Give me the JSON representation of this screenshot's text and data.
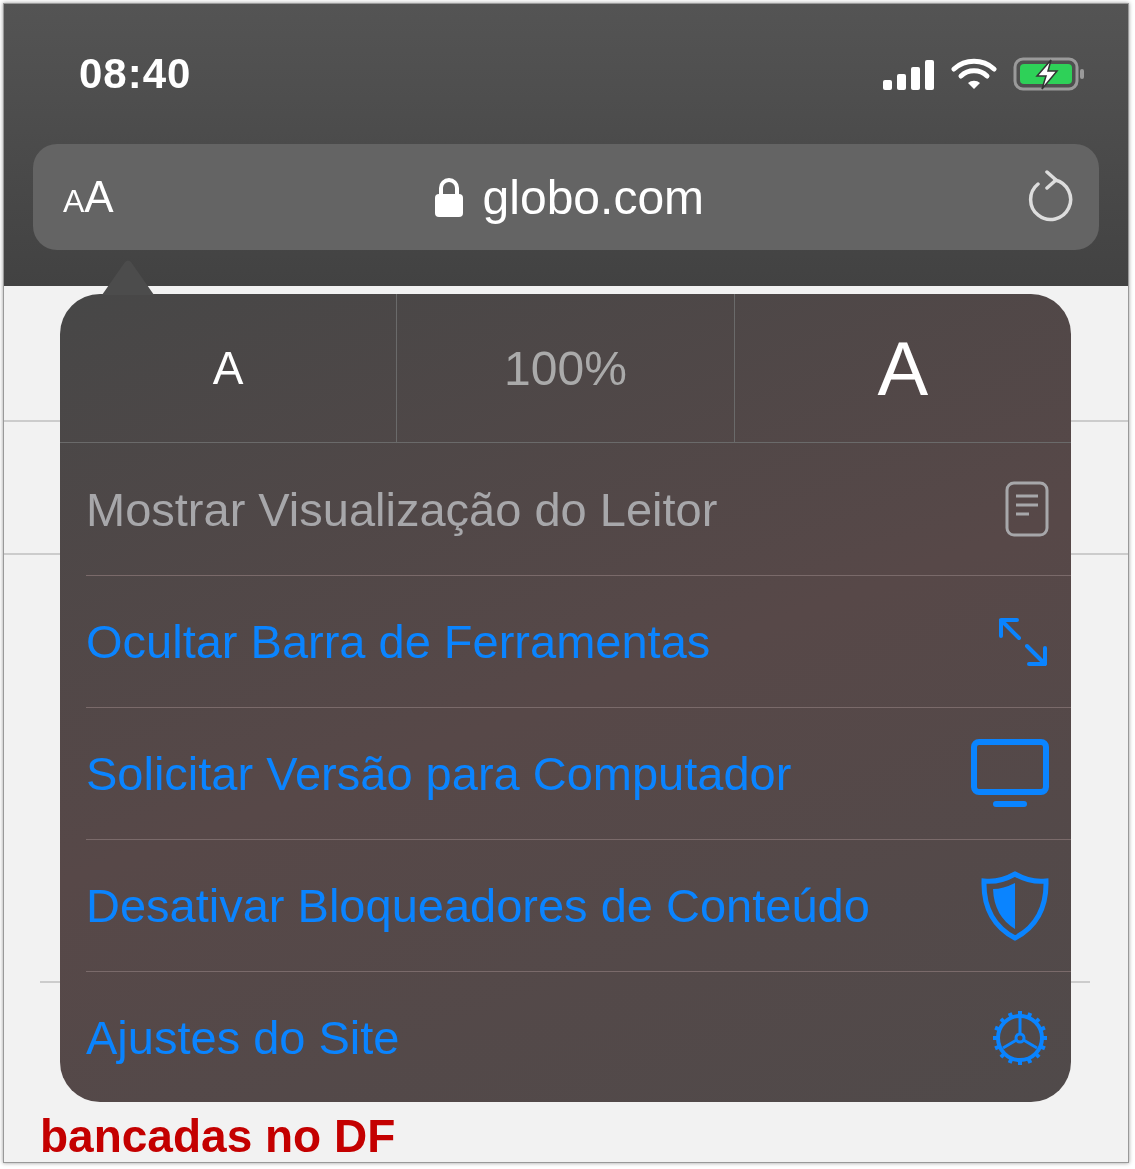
{
  "status_bar": {
    "time": "08:40",
    "battery_charging": true
  },
  "address_bar": {
    "text_size_small": "A",
    "text_size_large": "A",
    "secure": true,
    "domain": "globo.com"
  },
  "page": {
    "headline": "bancadas no DF"
  },
  "menu": {
    "zoom": {
      "decrease": "A",
      "level": "100%",
      "increase": "A"
    },
    "items": [
      {
        "label": "Mostrar Visualização do Leitor",
        "kind": "reader",
        "disabled": true
      },
      {
        "label": "Ocultar Barra de Ferramentas",
        "kind": "expand",
        "disabled": false
      },
      {
        "label": "Solicitar Versão para Computador",
        "kind": "desktop",
        "disabled": false
      },
      {
        "label": "Desativar Bloqueadores de Conteúdo",
        "kind": "shield",
        "disabled": false
      },
      {
        "label": "Ajustes do Site",
        "kind": "gear",
        "disabled": false
      }
    ]
  }
}
